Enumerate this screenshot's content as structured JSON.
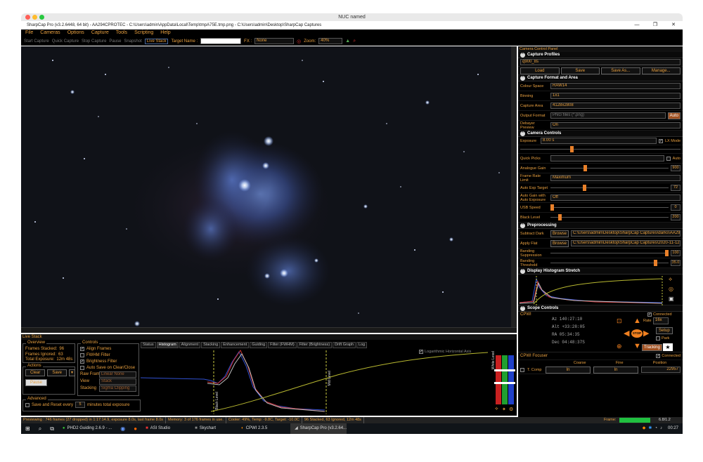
{
  "mac_title": "NUC named",
  "window_title": "SharpCap Pro (v3.2.6448, 64 bit) - AA294CPROTEC - C:\\Users\\admin\\AppData\\Local\\Temp\\tmpA75E.tmp.png - C:\\Users\\admin\\Desktop\\SharpCap Captures",
  "window_controls": {
    "minimize": "—",
    "maximize": "❐",
    "close": "✕"
  },
  "menu": [
    "File",
    "Cameras",
    "Options",
    "Capture",
    "Tools",
    "Scripting",
    "Help"
  ],
  "toolbar": {
    "start_capture": "Start Capture",
    "quick_capture": "Quick Capture",
    "stop_capture": "Stop Capture",
    "pause": "Pause",
    "snapshot": "Snapshot",
    "live_stack": "Live Stack",
    "target_name_label": "Target Name :",
    "target_name_value": "",
    "fx_label": "FX :",
    "fx_value": "None",
    "zoom_label": "Zoom:",
    "zoom_value": "40%"
  },
  "live_stack": {
    "title": "Live Stack",
    "overview": {
      "title": "Overview",
      "frames_stacked_label": "Frames Stacked:",
      "frames_stacked": "96",
      "frames_ignored_label": "Frames Ignored:",
      "frames_ignored": "63",
      "total_exposure_label": "Total Exposure:",
      "total_exposure": "12m 48s"
    },
    "actions": {
      "title": "Actions",
      "clear": "Clear",
      "save": "Save",
      "pause": "Pause"
    },
    "advanced": {
      "title": "Advanced",
      "save_reset_label": "Save and Reset every",
      "save_reset_value": "5",
      "minutes_label": "minutes total exposure"
    },
    "controls": {
      "title": "Controls",
      "align_frames": "Align Frames",
      "fwhm_filter": "FWHM Filter",
      "brightness_filter": "Brightness Filter",
      "auto_save": "Auto Save on Clear/Close",
      "raw_frames_label": "Raw Frames",
      "raw_frames_value": "Linear None",
      "view_label": "View",
      "view_value": "Stack",
      "stacking_label": "Stacking",
      "stacking_value": "Sigma Clipping"
    },
    "tabs": [
      "Status",
      "Histogram",
      "Alignment",
      "Stacking",
      "Enhancement",
      "Guiding",
      "Filter (FWHM)",
      "Filter (Brightness)",
      "Drift Graph",
      "Log"
    ],
    "active_tab": "Histogram",
    "histogram": {
      "log_label": "Logarithmic Horizontal Axis",
      "black_level": "Black Level",
      "mid_level": "Mid Level",
      "white_level": "White Level"
    }
  },
  "status_bar": [
    "Previewing : 746 frames (27 dropped) in 1:17:14.9, exposure 8.0s, last frame 8.0s",
    "Memory: 3 of 176 frames in use.",
    "Cooler: 49%, Temp: -9.8C, Target: -10.0C",
    "96 Stacked, 63 Ignored, 12m 48s"
  ],
  "panel": {
    "title": "Camera Control Panel",
    "capture_profiles": {
      "title": "Capture Profiles",
      "profile": "q900_8s",
      "load": "Load",
      "save": "Save",
      "save_as": "Save As...",
      "manage": "Manage..."
    },
    "capture_format": {
      "title": "Capture Format and Area",
      "colour_space_label": "Colour Space",
      "colour_space": "RAW14",
      "binning_label": "Binning",
      "binning": "1x1",
      "capture_area_label": "Capture Area",
      "capture_area": "4128x2808",
      "output_format_label": "Output Format",
      "output_format": "PNG files (*.png)",
      "auto": "Auto",
      "debayer_label": "Debayer Preview",
      "debayer": "On"
    },
    "camera_controls": {
      "title": "Camera Controls",
      "exposure_label": "Exposure",
      "exposure": "8.00 s",
      "lx_mode": "LX Mode",
      "exposure_pos": 0.32,
      "quick_picks_label": "Quick Picks",
      "quick_picks_auto": "Auto",
      "analogue_gain_label": "Analogue Gain",
      "analogue_gain": "900",
      "analogue_gain_pos": 0.29,
      "frame_rate_label": "Frame Rate Limit",
      "frame_rate": "Maximum",
      "auto_exp_target_label": "Auto Exp Target",
      "auto_exp_target": "72",
      "auto_exp_target_pos": 0.28,
      "auto_gain_label": "Auto Gain with Auto Exposure",
      "auto_gain": "Off",
      "usb_speed_label": "USB Speed",
      "usb_speed": "0",
      "usb_speed_pos": 0.0,
      "black_level_label": "Black Level",
      "black_level": "200",
      "black_level_pos": 0.07
    },
    "preprocessing": {
      "title": "Preprocessing",
      "subtract_dark_label": "Subtract Dark",
      "browse": "Browse",
      "subtract_dark_path": "C:\\Users\\admin\\Desktop\\SharpCap Captures\\darks\\AA29...",
      "apply_flat_label": "Apply Flat",
      "apply_flat_path": "C:\\Users\\admin\\Desktop\\SharpCap Captures\\2020-11-12...",
      "banding_suppression_label": "Banding Suppression",
      "banding_suppression": "100",
      "banding_suppression_pos": 1.0,
      "banding_threshold_label": "Banding Threshold",
      "banding_threshold": "35.0",
      "banding_threshold_pos": 0.9
    },
    "display_histogram": {
      "title": "Display Histogram Stretch"
    },
    "scope_controls": {
      "title": "Scope Controls",
      "mount": "CPWI",
      "connected": "Connected",
      "az": "Az   140:27:10",
      "alt": "Alt  +33:28:05",
      "ra": "RA   05:34:35",
      "dec": "Dec  04:48:37S",
      "rate_label": "Rate",
      "rate": "16x",
      "setup": "Setup",
      "park": "Park",
      "tracking": "Tracking",
      "stop": "STOP"
    },
    "focuser": {
      "title": "CPWI Focuser",
      "connected": "Connected",
      "coarse": "Coarse",
      "fine": "Fine",
      "position_label": "Position",
      "t_comp": "T. Comp",
      "in": "In",
      "position": "22957"
    },
    "frame_label": "Frame:",
    "frame_value": "6.8/1.2"
  },
  "taskbar": {
    "items": [
      "PHD2 Guiding 2.6.9 - ...",
      "ASI Studio",
      "Skychart",
      "CPWI 2.3.5",
      "SharpCap Pro (v3.2.64..."
    ],
    "time": "00:27"
  },
  "colors": {
    "accent": "#e8a040",
    "panel_bg": "#000000",
    "slider_thumb": "#e8802a"
  }
}
